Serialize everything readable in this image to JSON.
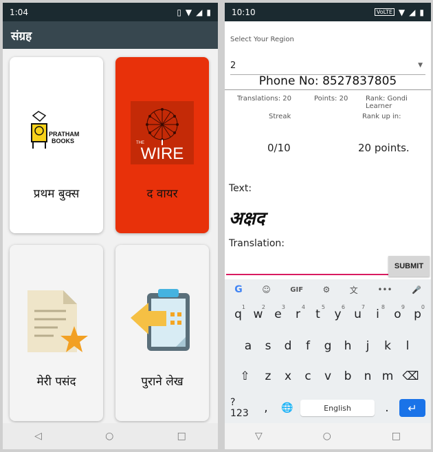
{
  "left": {
    "status": {
      "time": "1:04"
    },
    "appbar": {
      "title": "संग्रह"
    },
    "cards": [
      {
        "title": "प्रथम बुक्स",
        "logo_text_1": "PRATHAM",
        "logo_text_2": "BOOKS"
      },
      {
        "title": "द वायर",
        "logo_small": "THE",
        "logo_text": "WIRE"
      },
      {
        "title": "मेरी पसंद"
      },
      {
        "title": "पुराने लेख"
      }
    ]
  },
  "right": {
    "status": {
      "time": "10:10",
      "badge": "VoLTE"
    },
    "region": {
      "label": "Select Your Region",
      "value": "2"
    },
    "phone": "Phone No: 8527837805",
    "stats": {
      "translations": "Translations: 20",
      "points": "Points: 20",
      "rank": "Rank: Gondi Learner",
      "streak_label": "Streak",
      "rankup_label": "Rank up in:",
      "streak_value": "0/10",
      "rankup_value": "20 points."
    },
    "text_label": "Text:",
    "word": "अक्षद",
    "translation_label": "Translation:",
    "translation_value": "",
    "submit_label": "SUBMIT",
    "keyboard": {
      "toolbar": [
        "G",
        "☺",
        "GIF",
        "⚙",
        "文",
        "•••",
        "🎤"
      ],
      "row1": [
        [
          "q",
          "1"
        ],
        [
          "w",
          "2"
        ],
        [
          "e",
          "3"
        ],
        [
          "r",
          "4"
        ],
        [
          "t",
          "5"
        ],
        [
          "y",
          "6"
        ],
        [
          "u",
          "7"
        ],
        [
          "i",
          "8"
        ],
        [
          "o",
          "9"
        ],
        [
          "p",
          "0"
        ]
      ],
      "row2": [
        "a",
        "s",
        "d",
        "f",
        "g",
        "h",
        "j",
        "k",
        "l"
      ],
      "row3": [
        "⇧",
        "z",
        "x",
        "c",
        "v",
        "b",
        "n",
        "m",
        "⌫"
      ],
      "row4": {
        "sym": "?123",
        "comma": ",",
        "globe": "🌐",
        "space": "English",
        "period": ".",
        "enter": "↵"
      }
    }
  },
  "colors": {
    "wire_red": "#e8310a",
    "accent_pink": "#d81b60",
    "enter_blue": "#1a73e8",
    "appbar": "#37474f"
  }
}
